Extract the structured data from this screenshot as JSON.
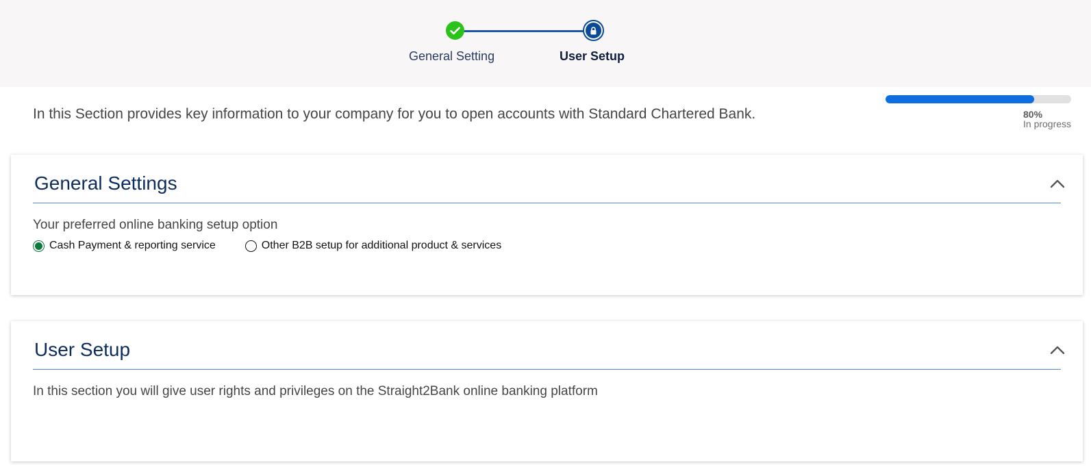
{
  "stepper": {
    "steps": [
      {
        "label": "General Setting",
        "state": "completed",
        "icon": "check-icon"
      },
      {
        "label": "User Setup",
        "state": "current",
        "icon": "lock-icon"
      }
    ]
  },
  "intro": {
    "text": "In this Section provides key information to your company for you to open accounts with Standard Chartered Bank."
  },
  "progress": {
    "value_fraction": 0.8,
    "percent_label": "80%",
    "status": "In progress"
  },
  "general_settings": {
    "title": "General Settings",
    "expanded": true,
    "toggle_icon": "chevron-up-icon",
    "question": "Your preferred online banking setup option",
    "options": [
      {
        "label": "Cash Payment & reporting service",
        "selected": true
      },
      {
        "label": "Other B2B setup for additional product & services",
        "selected": false
      }
    ]
  },
  "user_setup": {
    "title": "User Setup",
    "expanded": true,
    "toggle_icon": "chevron-up-icon",
    "description": "In this section you will give user rights and privileges on the Straight2Bank online banking platform"
  },
  "colors": {
    "step_complete": "#2bc21b",
    "step_current": "#0a4a96",
    "progress_fill": "#0c6ee0",
    "radio_selected": "#0b7a3a",
    "heading": "#0d2c5e"
  }
}
